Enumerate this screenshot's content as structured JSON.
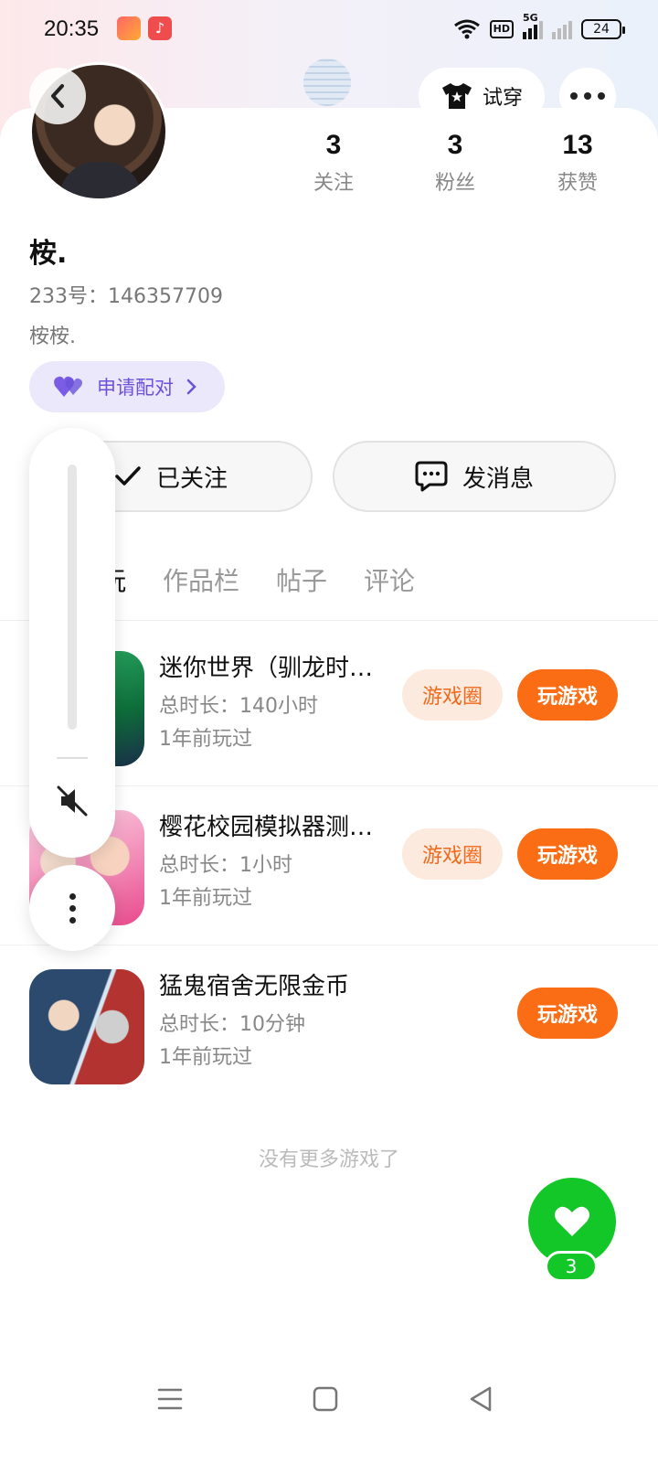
{
  "status_bar": {
    "time": "20:35",
    "network": "5G",
    "hd": "HD",
    "battery": "24"
  },
  "header": {
    "try_on_label": "试穿"
  },
  "profile": {
    "stats": [
      {
        "value": "3",
        "label": "关注"
      },
      {
        "value": "3",
        "label": "粉丝"
      },
      {
        "value": "13",
        "label": "获赞"
      }
    ],
    "nickname": "桉.",
    "id_line": "233号：146357709",
    "bio": "桉桉.",
    "pair_label": "申请配对"
  },
  "actions": {
    "follow_label": "已关注",
    "message_label": "发消息"
  },
  "tabs": [
    {
      "label": "玩",
      "active": true
    },
    {
      "label": "作品栏",
      "active": false
    },
    {
      "label": "帖子",
      "active": false
    },
    {
      "label": "评论",
      "active": false
    }
  ],
  "games": [
    {
      "name": "迷你世界（驯龙时…",
      "duration": "总时长：140小时",
      "played": "1年前玩过",
      "circle_label": "游戏圈",
      "play_label": "玩游戏"
    },
    {
      "name": "樱花校园模拟器测…",
      "duration": "总时长：1小时",
      "played": "1年前玩过",
      "circle_label": "游戏圈",
      "play_label": "玩游戏"
    },
    {
      "name": "猛鬼宿舍无限金币",
      "duration": "总时长：10分钟",
      "played": "1年前玩过",
      "play_label": "玩游戏"
    }
  ],
  "footer_note": "没有更多游戏了",
  "like": {
    "count": "3"
  },
  "colors": {
    "accent": "#fb6d14",
    "like_green": "#14c728",
    "pair_purple": "#6b52d9"
  }
}
